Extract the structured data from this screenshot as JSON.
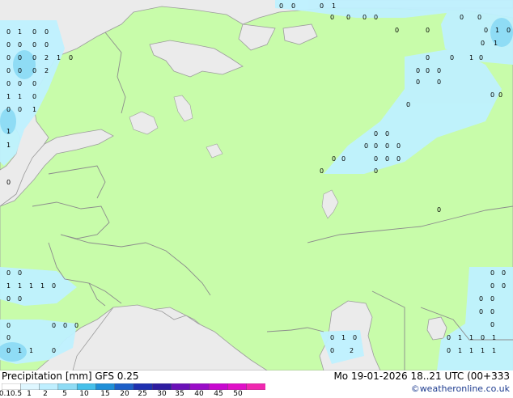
{
  "map": {
    "colors": {
      "sea": "#ebebeb",
      "land": "#c8fcaa",
      "border": "#8c8c8c",
      "coast": "#9c9c9c",
      "precip_light": "#bff1ff",
      "precip_med": "#8fdcf5"
    },
    "precip_symbol": "o"
  },
  "footer": {
    "title_left": "Precipitation [mm]  GFS 0.25",
    "title_right": "Mo 19-01-2026 18..21 UTC (00+333",
    "credit": "©weatheronline.co.uk",
    "legend": {
      "ticks": [
        "0.1",
        "0.5",
        "1",
        "2",
        "5",
        "10",
        "15",
        "20",
        "25",
        "30",
        "35",
        "40",
        "45",
        "50"
      ],
      "colors": [
        "#ffffff",
        "#dff7ff",
        "#bfefff",
        "#8fdcf5",
        "#46c0ea",
        "#1f8fd8",
        "#1d5fc8",
        "#1e30b0",
        "#2e1ca0",
        "#6a10b8",
        "#9a0cc8",
        "#c808d0",
        "#e010c8",
        "#f028b0"
      ]
    }
  }
}
